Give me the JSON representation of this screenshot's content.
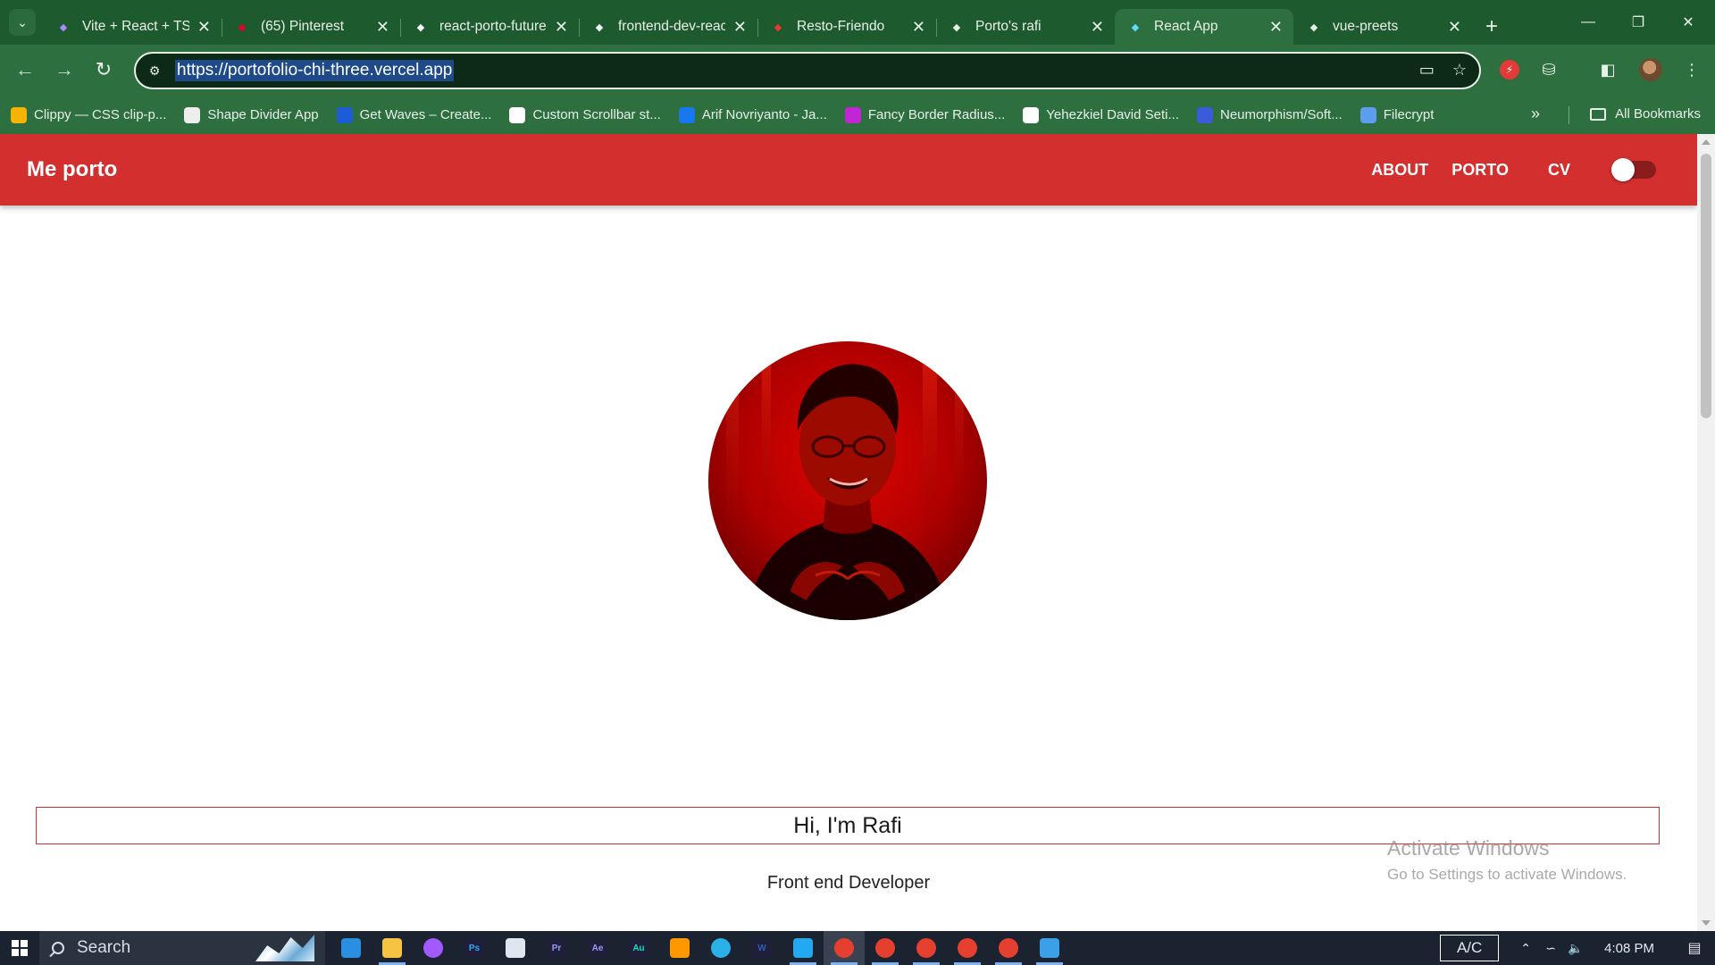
{
  "browser": {
    "tabs": [
      {
        "title": "Vite + React + TS",
        "favicon": "vite-icon",
        "color": "#a78bfa"
      },
      {
        "title": "(65) Pinterest",
        "favicon": "pinterest-icon",
        "color": "#e60023"
      },
      {
        "title": "react-porto-future",
        "favicon": "vercel-icon",
        "color": "#ffffff"
      },
      {
        "title": "frontend-dev-react",
        "favicon": "vercel-icon",
        "color": "#ffffff"
      },
      {
        "title": "Resto-Friendo",
        "favicon": "resto-icon",
        "color": "#e53935"
      },
      {
        "title": "Porto's rafi",
        "favicon": "netlify-icon",
        "color": "#e8f0ea"
      },
      {
        "title": "React App",
        "favicon": "react-icon",
        "color": "#61dafb"
      },
      {
        "title": "vue-preets",
        "favicon": "netlify-icon",
        "color": "#e8f0ea"
      }
    ],
    "active_tab_index": 6,
    "url": "https://portofolio-chi-three.vercel.app",
    "bookmarks": [
      {
        "label": "Clippy — CSS clip-p...",
        "icon": "clippy-icon",
        "color": "#f4b400"
      },
      {
        "label": "Shape Divider App",
        "icon": "shape-divider-icon",
        "color": "#eeeeee"
      },
      {
        "label": "Get Waves – Create...",
        "icon": "waves-icon",
        "color": "#1e5bd7"
      },
      {
        "label": "Custom Scrollbar st...",
        "icon": "codepen-icon",
        "color": "#ffffff"
      },
      {
        "label": "Arif Novriyanto - Ja...",
        "icon": "facebook-icon",
        "color": "#1877f2"
      },
      {
        "label": "Fancy Border Radius...",
        "icon": "blob-icon",
        "color": "#c026d3"
      },
      {
        "label": "Yehezkiel David Seti...",
        "icon": "diamond-icon",
        "color": "#ffffff"
      },
      {
        "label": "Neumorphism/Soft...",
        "icon": "neumorphism-icon",
        "color": "#3b5bdb"
      },
      {
        "label": "Filecrypt",
        "icon": "filecrypt-icon",
        "color": "#5c9ded"
      }
    ],
    "all_bookmarks_label": "All Bookmarks"
  },
  "site": {
    "brand": "Me porto",
    "nav": {
      "about": "ABOUT",
      "porto": "PORTO",
      "cv": "CV"
    },
    "theme_toggle_on": false,
    "hero": {
      "title": "Hi, I'm Rafi",
      "subtitle": "Front end Developer"
    },
    "accent": "#d32f2f"
  },
  "windows": {
    "watermark_title": "Activate Windows",
    "watermark_sub": "Go to Settings to activate Windows.",
    "taskbar": {
      "search_placeholder": "Search",
      "apps": [
        {
          "name": "mail-icon",
          "color": "#2a8fe0",
          "running": false
        },
        {
          "name": "file-explorer-icon",
          "color": "#f6c343",
          "running": true
        },
        {
          "name": "copilot-icon",
          "color": "#a259ff",
          "running": false
        },
        {
          "name": "photoshop-icon",
          "label": "Ps",
          "color": "#31a8ff",
          "running": false
        },
        {
          "name": "notepad-icon",
          "color": "#dfe6f0",
          "running": false
        },
        {
          "name": "premiere-icon",
          "label": "Pr",
          "color": "#9999ff",
          "running": false
        },
        {
          "name": "after-effects-icon",
          "label": "Ae",
          "color": "#9999ff",
          "running": false
        },
        {
          "name": "audition-icon",
          "label": "Au",
          "color": "#00e4bb",
          "running": false
        },
        {
          "name": "sublime-icon",
          "color": "#ff9800",
          "running": false
        },
        {
          "name": "edge-icon",
          "color": "#2cb0e8",
          "running": false
        },
        {
          "name": "word-icon",
          "label": "W",
          "color": "#2b5fb4",
          "running": false
        },
        {
          "name": "vscode-icon",
          "color": "#23a9f2",
          "running": true
        },
        {
          "name": "chrome-icon",
          "color": "#e5402f",
          "running": true,
          "active": true
        },
        {
          "name": "chrome-icon",
          "color": "#e5402f",
          "running": true
        },
        {
          "name": "chrome-icon",
          "color": "#e5402f",
          "running": true
        },
        {
          "name": "chrome-icon",
          "color": "#e5402f",
          "running": true
        },
        {
          "name": "chrome-icon",
          "color": "#e5402f",
          "running": true
        },
        {
          "name": "photos-icon",
          "color": "#3ca0e8",
          "running": true
        }
      ],
      "tray_box": "A/C",
      "clock": "4:08 PM"
    }
  }
}
